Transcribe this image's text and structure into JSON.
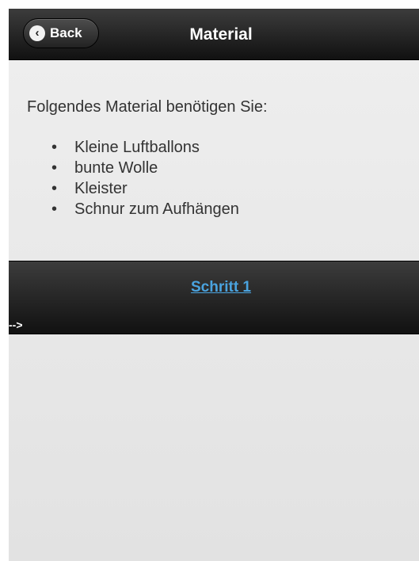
{
  "header": {
    "back_label": "Back",
    "back_icon": "chevron-left-icon",
    "title": "Material"
  },
  "content": {
    "intro": "Folgendes Material benötigen Sie:",
    "bullet_char": "•",
    "items": [
      {
        "label": "Kleine Luftballons"
      },
      {
        "label": "bunte Wolle"
      },
      {
        "label": "Kleister"
      },
      {
        "label": "Schnur zum Aufhängen"
      }
    ]
  },
  "footer": {
    "next_link": "Schritt 1",
    "stray_text": "-->"
  },
  "colors": {
    "bar": "#1c1c1c",
    "page_bg": "#e8e8e8",
    "link": "#4aa3df",
    "text": "#333333"
  }
}
